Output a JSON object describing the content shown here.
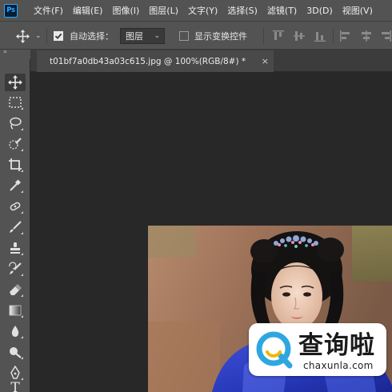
{
  "app": {
    "logo_text": "Ps",
    "menu": [
      "文件(F)",
      "编辑(E)",
      "图像(I)",
      "图层(L)",
      "文字(Y)",
      "选择(S)",
      "滤镜(T)",
      "3D(D)",
      "视图(V)"
    ]
  },
  "options_bar": {
    "tool_icon": "move-icon",
    "auto_select_checked": true,
    "auto_select_label": "自动选择：",
    "auto_select_target": "图层",
    "transform_controls_checked": false,
    "transform_controls_label": "显示变换控件",
    "align_icons": [
      "align-top-icon",
      "align-vertical-center-icon",
      "align-bottom-icon",
      "align-left-icon",
      "align-horizontal-center-icon",
      "align-right-icon"
    ]
  },
  "panel_collapse_glyph": "»",
  "document_tab": {
    "title": "t01bf7a0db43a03c615.jpg @ 100%(RGB/8#) *",
    "close_glyph": "×"
  },
  "tools": [
    {
      "name": "move-tool",
      "icon": "move-icon",
      "active": true
    },
    {
      "name": "marquee-tool",
      "icon": "rectangular-marquee-icon"
    },
    {
      "name": "lasso-tool",
      "icon": "lasso-icon"
    },
    {
      "name": "quick-selection-tool",
      "icon": "quick-selection-icon"
    },
    {
      "name": "crop-tool",
      "icon": "crop-icon"
    },
    {
      "name": "eyedropper-tool",
      "icon": "eyedropper-icon"
    },
    {
      "name": "healing-brush-tool",
      "icon": "healing-brush-icon"
    },
    {
      "name": "brush-tool",
      "icon": "brush-icon"
    },
    {
      "name": "clone-stamp-tool",
      "icon": "clone-stamp-icon"
    },
    {
      "name": "history-brush-tool",
      "icon": "history-brush-icon"
    },
    {
      "name": "eraser-tool",
      "icon": "eraser-icon"
    },
    {
      "name": "gradient-tool",
      "icon": "gradient-icon"
    },
    {
      "name": "blur-tool",
      "icon": "blur-drop-icon"
    },
    {
      "name": "dodge-tool",
      "icon": "dodge-icon"
    },
    {
      "name": "pen-tool",
      "icon": "pen-icon"
    },
    {
      "name": "type-tool",
      "icon": "type-icon",
      "glyph": "T"
    }
  ],
  "watermark": {
    "title": "查询啦",
    "url": "chaxunla.com",
    "accent": "#2ea7e0"
  },
  "colors": {
    "chrome": "#535353",
    "canvas": "#282828",
    "tab_bar": "#3c3c3c",
    "active_tab": "#494949",
    "ps_blue": "#31a8ff"
  }
}
